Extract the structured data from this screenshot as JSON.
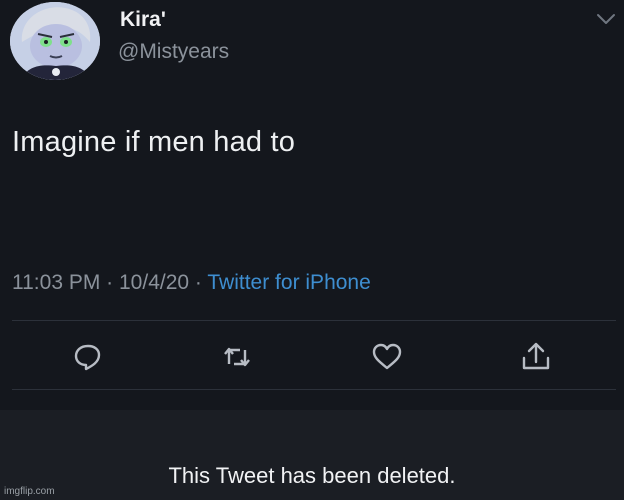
{
  "tweet": {
    "display_name": "Kira'",
    "handle": "@Mistyears",
    "text": "Imagine if men had to",
    "time": "11:03 PM",
    "date": "10/4/20",
    "separator": " · ",
    "source": "Twitter for iPhone",
    "avatar_icon": "cartoon-avatar",
    "menu_icon": "chevron-down-icon"
  },
  "actions": [
    {
      "name": "reply",
      "icon": "reply-icon"
    },
    {
      "name": "retweet",
      "icon": "retweet-icon"
    },
    {
      "name": "like",
      "icon": "heart-icon"
    },
    {
      "name": "share",
      "icon": "share-icon"
    }
  ],
  "deleted_notice": "This Tweet has been deleted.",
  "watermark": "imgflip.com",
  "colors": {
    "background": "#14171d",
    "link": "#3e8ed0",
    "muted": "#8b929b",
    "text": "#eef0f2"
  }
}
